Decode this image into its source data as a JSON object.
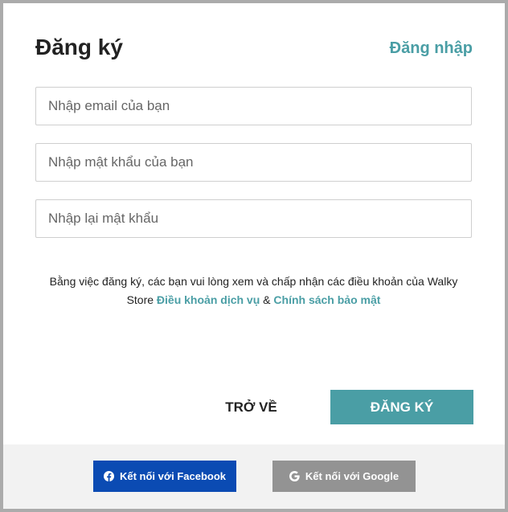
{
  "modal": {
    "title": "Đăng ký",
    "login_link": "Đăng nhập"
  },
  "form": {
    "email_placeholder": "Nhập email của bạn",
    "password_placeholder": "Nhập mật khẩu của bạn",
    "confirm_placeholder": "Nhập lại mật khẩu",
    "email_value": "",
    "password_value": "",
    "confirm_value": ""
  },
  "terms": {
    "prefix": "Bằng việc đăng ký, các bạn vui lòng xem và chấp nhận các điều khoản của Walky Store",
    "terms_link": "Điều khoản dịch vụ",
    "separator": "&",
    "privacy_link": "Chính sách bảo mật"
  },
  "actions": {
    "back_label": "TRỞ VỀ",
    "signup_label": "ĐĂNG KÝ"
  },
  "social": {
    "facebook_label": "Kết nối với Facebook",
    "facebook_icon": "facebook-icon",
    "google_label": "Kết nối với Google",
    "google_icon": "google-icon"
  },
  "colors": {
    "accent": "#4a9ea5",
    "facebook": "#0b4bb3",
    "google_button": "#939393",
    "overlay": "#ababab",
    "footer_bg": "#f2f2f2"
  }
}
